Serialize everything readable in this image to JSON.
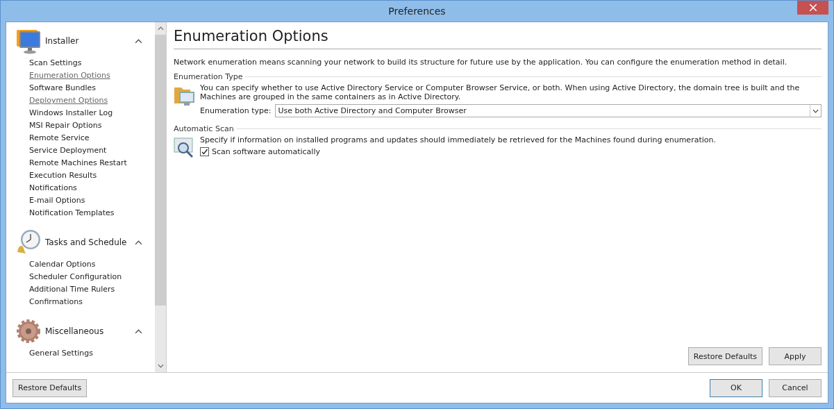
{
  "window": {
    "title": "Preferences"
  },
  "sidebar": {
    "groups": [
      {
        "title": "Installer",
        "expanded": true,
        "items": [
          {
            "label": "Scan Settings",
            "highlighted": false
          },
          {
            "label": "Enumeration Options",
            "highlighted": true
          },
          {
            "label": "Software Bundles",
            "highlighted": false
          },
          {
            "label": "Deployment Options",
            "highlighted": true
          },
          {
            "label": "Windows Installer Log",
            "highlighted": false
          },
          {
            "label": "MSI Repair Options",
            "highlighted": false
          },
          {
            "label": "Remote Service",
            "highlighted": false
          },
          {
            "label": "Service Deployment",
            "highlighted": false
          },
          {
            "label": "Remote Machines Restart",
            "highlighted": false
          },
          {
            "label": "Execution Results",
            "highlighted": false
          },
          {
            "label": "Notifications",
            "highlighted": false
          },
          {
            "label": "E-mail Options",
            "highlighted": false
          },
          {
            "label": "Notification Templates",
            "highlighted": false
          }
        ]
      },
      {
        "title": "Tasks and Schedule",
        "expanded": true,
        "items": [
          {
            "label": "Calendar Options",
            "highlighted": false
          },
          {
            "label": "Scheduler Configuration",
            "highlighted": false
          },
          {
            "label": "Additional Time Rulers",
            "highlighted": false
          },
          {
            "label": "Confirmations",
            "highlighted": false
          }
        ]
      },
      {
        "title": "Miscellaneous",
        "expanded": true,
        "items": [
          {
            "label": "General Settings",
            "highlighted": false
          }
        ]
      }
    ]
  },
  "content": {
    "title": "Enumeration Options",
    "intro": "Network enumeration means scanning your network to build its structure for future use by the application. You can configure the enumeration method in detail.",
    "sections": [
      {
        "kind": "select",
        "heading": "Enumeration Type",
        "text": "You can specify whether to use Active Directory Service or Computer Browser Service, or both. When using Active Directory, the domain tree is built and the Machines are grouped in the same containers as in Active Directory.",
        "field_label": "Enumeration type:",
        "value": "Use both Active Directory and Computer Browser"
      },
      {
        "kind": "checkbox",
        "heading": "Automatic Scan",
        "text": "Specify if information on installed programs and updates should immediately be retrieved for the Machines found during enumeration.",
        "field_label": "Scan software automatically",
        "checked": true
      }
    ],
    "buttons": [
      "Restore Defaults",
      "Apply"
    ]
  },
  "footer": {
    "left_button": "Restore Defaults",
    "buttons": [
      "OK",
      "Cancel"
    ]
  }
}
